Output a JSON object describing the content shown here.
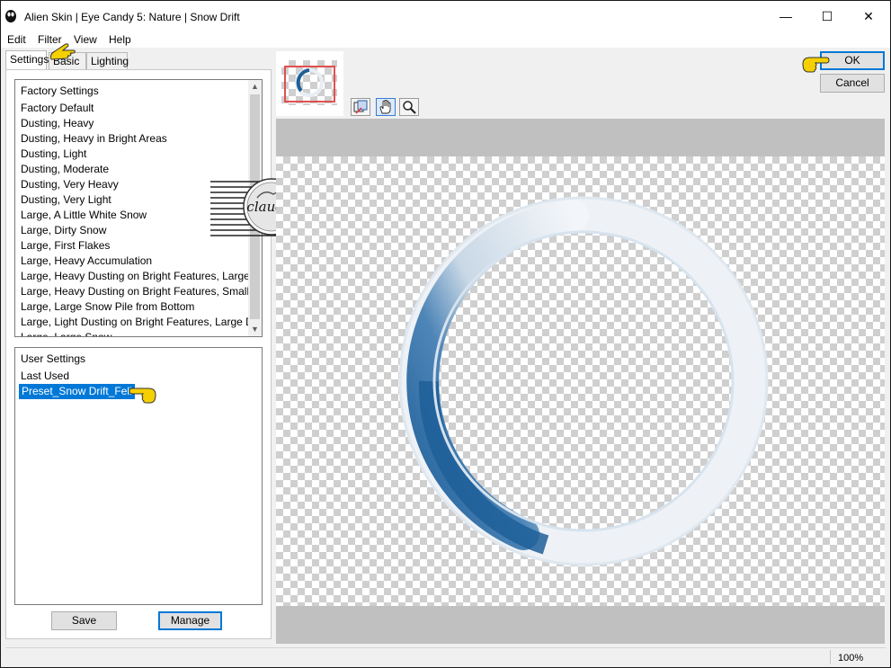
{
  "window": {
    "title": "Alien Skin | Eye Candy 5: Nature | Snow Drift",
    "controls": {
      "minimize": "—",
      "maximize": "☐",
      "close": "✕"
    }
  },
  "menu": [
    "Edit",
    "Filter",
    "View",
    "Help"
  ],
  "tabs": [
    {
      "label": "Settings",
      "active": true
    },
    {
      "label": "Basic",
      "active": false
    },
    {
      "label": "Lighting",
      "active": false
    }
  ],
  "factory_settings": {
    "header": "Factory Settings",
    "items": [
      "Factory Default",
      "Dusting, Heavy",
      "Dusting, Heavy in Bright Areas",
      "Dusting, Light",
      "Dusting, Moderate",
      "Dusting, Very Heavy",
      "Dusting, Very Light",
      "Large, A Little White Snow",
      "Large, Dirty Snow",
      "Large, First Flakes",
      "Large, Heavy Accumulation",
      "Large, Heavy Dusting on Bright Features, Large Drift",
      "Large, Heavy Dusting on Bright Features, Small Drift",
      "Large, Large Snow Pile from Bottom",
      "Large, Light Dusting on Bright Features, Large Drift",
      "Large, Large Snow..."
    ]
  },
  "user_settings": {
    "header": "User Settings",
    "items": [
      "Last Used",
      "Preset_Snow Drift_Feli"
    ],
    "selected": "Preset_Snow Drift_Feli"
  },
  "buttons": {
    "save": "Save",
    "manage": "Manage",
    "ok": "OK",
    "cancel": "Cancel"
  },
  "watermark": {
    "text": "claudia"
  },
  "status": {
    "zoom": "100%"
  },
  "colors": {
    "accent": "#0078d7",
    "ring_blue": "#1e5f99",
    "pointer_yellow": "#f5d000"
  }
}
